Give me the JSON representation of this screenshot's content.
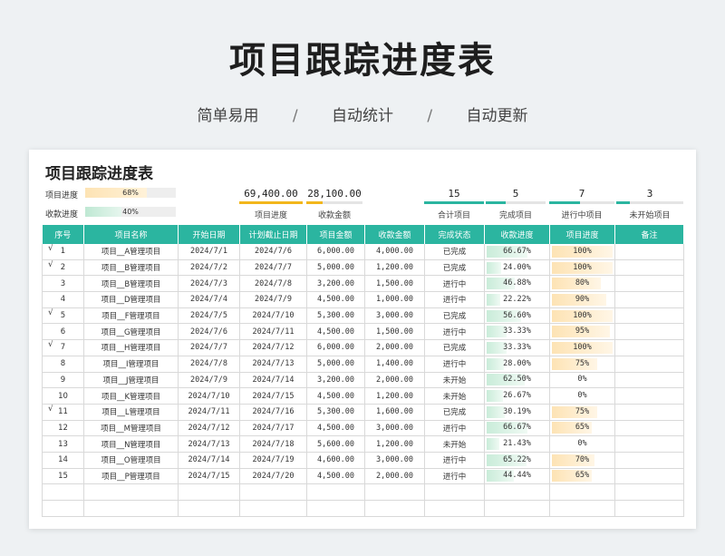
{
  "hero": {
    "title": "项目跟踪进度表",
    "sub": [
      "简单易用",
      "自动统计",
      "自动更新"
    ],
    "separator": "/"
  },
  "sheet": {
    "title": "项目跟踪进度表",
    "project_progress_label": "项目进度",
    "project_progress_value": "68%",
    "project_progress_fraction": 0.68,
    "collection_progress_label": "收款进度",
    "collection_progress_value": "40%",
    "collection_progress_fraction": 0.4,
    "amounts": [
      {
        "value": "69,400.00",
        "caption": "项目进度",
        "color": "#f2b61c"
      },
      {
        "value": "28,100.00",
        "caption": "收款金额",
        "color": "#f2b61c"
      }
    ],
    "counts": [
      {
        "value": "15",
        "caption": "合计项目",
        "fraction": 1.0
      },
      {
        "value": "5",
        "caption": "完成项目",
        "fraction": 0.33
      },
      {
        "value": "7",
        "caption": "进行中项目",
        "fraction": 0.47
      },
      {
        "value": "3",
        "caption": "未开始项目",
        "fraction": 0.2
      }
    ]
  },
  "colors": {
    "header": "#2bb5a0",
    "green_fill": "#c9ecd9",
    "orange_fill": "#fde3b4"
  },
  "table": {
    "headers": [
      "序号",
      "项目名称",
      "开始日期",
      "计划截止日期",
      "项目金额",
      "收款金额",
      "完成状态",
      "收款进度",
      "项目进度",
      "备注"
    ],
    "rows": [
      {
        "chk": "√",
        "seq": "1",
        "name": "项目__A管理项目",
        "start": "2024/7/1",
        "end": "2024/7/6",
        "amount": "6,000.00",
        "paid": "4,000.00",
        "status": "已完成",
        "pay_pct": "66.67%",
        "pay_frac": 0.6667,
        "proj_pct": "100%",
        "proj_frac": 1.0,
        "note": ""
      },
      {
        "chk": "√",
        "seq": "2",
        "name": "项目__B管理项目",
        "start": "2024/7/2",
        "end": "2024/7/7",
        "amount": "5,000.00",
        "paid": "1,200.00",
        "status": "已完成",
        "pay_pct": "24.00%",
        "pay_frac": 0.24,
        "proj_pct": "100%",
        "proj_frac": 1.0,
        "note": ""
      },
      {
        "chk": "",
        "seq": "3",
        "name": "项目__B管理项目",
        "start": "2024/7/3",
        "end": "2024/7/8",
        "amount": "3,200.00",
        "paid": "1,500.00",
        "status": "进行中",
        "pay_pct": "46.88%",
        "pay_frac": 0.4688,
        "proj_pct": "80%",
        "proj_frac": 0.8,
        "note": ""
      },
      {
        "chk": "",
        "seq": "4",
        "name": "项目__D管理项目",
        "start": "2024/7/4",
        "end": "2024/7/9",
        "amount": "4,500.00",
        "paid": "1,000.00",
        "status": "进行中",
        "pay_pct": "22.22%",
        "pay_frac": 0.2222,
        "proj_pct": "90%",
        "proj_frac": 0.9,
        "note": ""
      },
      {
        "chk": "√",
        "seq": "5",
        "name": "项目__F管理项目",
        "start": "2024/7/5",
        "end": "2024/7/10",
        "amount": "5,300.00",
        "paid": "3,000.00",
        "status": "已完成",
        "pay_pct": "56.60%",
        "pay_frac": 0.566,
        "proj_pct": "100%",
        "proj_frac": 1.0,
        "note": ""
      },
      {
        "chk": "",
        "seq": "6",
        "name": "项目__G管理项目",
        "start": "2024/7/6",
        "end": "2024/7/11",
        "amount": "4,500.00",
        "paid": "1,500.00",
        "status": "进行中",
        "pay_pct": "33.33%",
        "pay_frac": 0.3333,
        "proj_pct": "95%",
        "proj_frac": 0.95,
        "note": ""
      },
      {
        "chk": "√",
        "seq": "7",
        "name": "项目__H管理项目",
        "start": "2024/7/7",
        "end": "2024/7/12",
        "amount": "6,000.00",
        "paid": "2,000.00",
        "status": "已完成",
        "pay_pct": "33.33%",
        "pay_frac": 0.3333,
        "proj_pct": "100%",
        "proj_frac": 1.0,
        "note": ""
      },
      {
        "chk": "",
        "seq": "8",
        "name": "项目__I管理项目",
        "start": "2024/7/8",
        "end": "2024/7/13",
        "amount": "5,000.00",
        "paid": "1,400.00",
        "status": "进行中",
        "pay_pct": "28.00%",
        "pay_frac": 0.28,
        "proj_pct": "75%",
        "proj_frac": 0.75,
        "note": ""
      },
      {
        "chk": "",
        "seq": "9",
        "name": "项目__J管理项目",
        "start": "2024/7/9",
        "end": "2024/7/14",
        "amount": "3,200.00",
        "paid": "2,000.00",
        "status": "未开始",
        "pay_pct": "62.50%",
        "pay_frac": 0.625,
        "proj_pct": "0%",
        "proj_frac": 0.0,
        "note": ""
      },
      {
        "chk": "",
        "seq": "10",
        "name": "项目__K管理项目",
        "start": "2024/7/10",
        "end": "2024/7/15",
        "amount": "4,500.00",
        "paid": "1,200.00",
        "status": "未开始",
        "pay_pct": "26.67%",
        "pay_frac": 0.2667,
        "proj_pct": "0%",
        "proj_frac": 0.0,
        "note": ""
      },
      {
        "chk": "√",
        "seq": "11",
        "name": "项目__L管理项目",
        "start": "2024/7/11",
        "end": "2024/7/16",
        "amount": "5,300.00",
        "paid": "1,600.00",
        "status": "已完成",
        "pay_pct": "30.19%",
        "pay_frac": 0.3019,
        "proj_pct": "75%",
        "proj_frac": 0.75,
        "note": ""
      },
      {
        "chk": "",
        "seq": "12",
        "name": "项目__M管理项目",
        "start": "2024/7/12",
        "end": "2024/7/17",
        "amount": "4,500.00",
        "paid": "3,000.00",
        "status": "进行中",
        "pay_pct": "66.67%",
        "pay_frac": 0.6667,
        "proj_pct": "65%",
        "proj_frac": 0.65,
        "note": ""
      },
      {
        "chk": "",
        "seq": "13",
        "name": "项目__N管理项目",
        "start": "2024/7/13",
        "end": "2024/7/18",
        "amount": "5,600.00",
        "paid": "1,200.00",
        "status": "未开始",
        "pay_pct": "21.43%",
        "pay_frac": 0.2143,
        "proj_pct": "0%",
        "proj_frac": 0.0,
        "note": ""
      },
      {
        "chk": "",
        "seq": "14",
        "name": "项目__O管理项目",
        "start": "2024/7/14",
        "end": "2024/7/19",
        "amount": "4,600.00",
        "paid": "3,000.00",
        "status": "进行中",
        "pay_pct": "65.22%",
        "pay_frac": 0.6522,
        "proj_pct": "70%",
        "proj_frac": 0.7,
        "note": ""
      },
      {
        "chk": "",
        "seq": "15",
        "name": "项目__P管理项目",
        "start": "2024/7/15",
        "end": "2024/7/20",
        "amount": "4,500.00",
        "paid": "2,000.00",
        "status": "进行中",
        "pay_pct": "44.44%",
        "pay_frac": 0.4444,
        "proj_pct": "65%",
        "proj_frac": 0.65,
        "note": ""
      }
    ],
    "empty_rows": 2
  }
}
